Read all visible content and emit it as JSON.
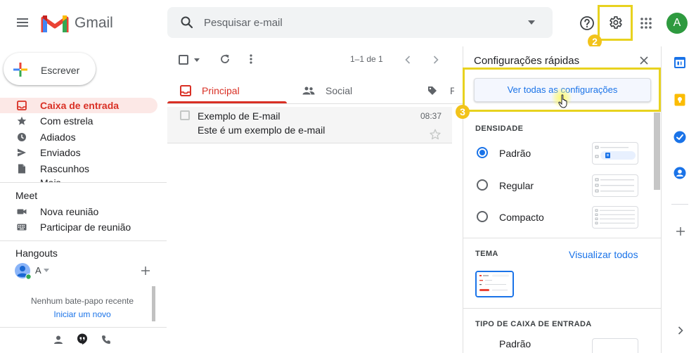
{
  "header": {
    "app_name": "Gmail",
    "search_placeholder": "Pesquisar e-mail",
    "avatar_letter": "A",
    "step_settings": "2"
  },
  "compose": {
    "label": "Escrever"
  },
  "nav": {
    "items": [
      {
        "label": "Caixa de entrada",
        "icon": "inbox-icon",
        "active": true
      },
      {
        "label": "Com estrela",
        "icon": "star-icon"
      },
      {
        "label": "Adiados",
        "icon": "clock-icon"
      },
      {
        "label": "Enviados",
        "icon": "send-icon"
      },
      {
        "label": "Rascunhos",
        "icon": "draft-icon"
      }
    ],
    "more_label": "Mais"
  },
  "meet": {
    "title": "Meet",
    "new_meeting": "Nova reunião",
    "join_meeting": "Participar de reunião"
  },
  "hangouts": {
    "title": "Hangouts",
    "user": "A",
    "empty_text": "Nenhum bate-papo recente",
    "start_link": "Iniciar um novo"
  },
  "toolbar": {
    "pager": "1–1 de 1"
  },
  "tabs": [
    {
      "label": "Principal",
      "icon": "inbox-icon",
      "active": true
    },
    {
      "label": "Social",
      "icon": "people-icon"
    },
    {
      "label": "Promoções",
      "icon": "tag-icon"
    }
  ],
  "mail": {
    "sender": "Exemplo de E-mail",
    "snippet": "Este é um exemplo de e-mail",
    "time": "08:37"
  },
  "quick_settings": {
    "title": "Configurações rápidas",
    "all_settings_button": "Ver todas as configurações",
    "step_badge": "3",
    "density_title": "DENSIDADE",
    "density_options": [
      {
        "label": "Padrão",
        "selected": true
      },
      {
        "label": "Regular",
        "selected": false
      },
      {
        "label": "Compacto",
        "selected": false
      }
    ],
    "theme_title": "TEMA",
    "theme_view_all": "Visualizar todos",
    "inbox_type_title": "TIPO DE CAIXA DE ENTRADA",
    "inbox_type_default": "Padrão"
  },
  "colors": {
    "accent_red": "#d93025",
    "accent_blue": "#1a73e8",
    "highlight_yellow": "#e8d21f",
    "badge_yellow": "#f2c31b",
    "avatar_green": "#2e9a3f"
  }
}
